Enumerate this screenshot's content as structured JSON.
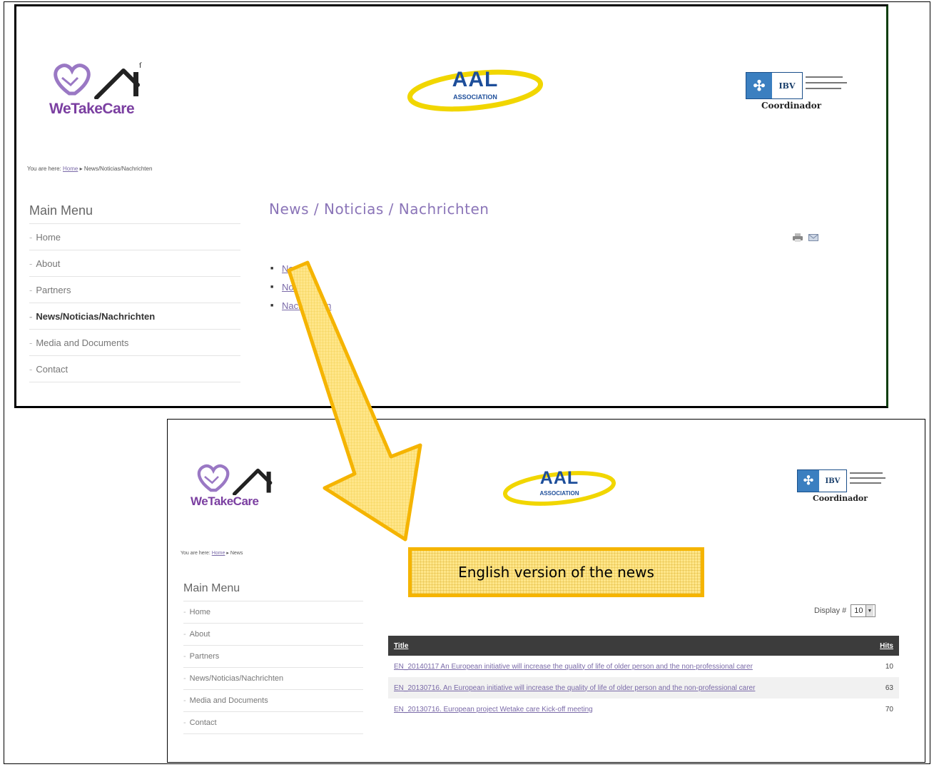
{
  "annotation": {
    "callout_text": "English version of the news",
    "arrow_color": "#f5b400"
  },
  "top_screenshot": {
    "logos": {
      "left_brand": "WeTakeCare",
      "center_brand": "AAL",
      "center_subtitle": "ASSOCIATION",
      "right_brand": "IBV",
      "right_caption": "Coordinador"
    },
    "breadcrumb": {
      "prefix": "You are here:",
      "home": "Home",
      "separator": "▸",
      "current": "News/Noticias/Nachrichten"
    },
    "menu": {
      "title": "Main Menu",
      "items": [
        {
          "label": "Home"
        },
        {
          "label": "About"
        },
        {
          "label": "Partners"
        },
        {
          "label": "News/Noticias/Nachrichten"
        },
        {
          "label": "Media and Documents"
        },
        {
          "label": "Contact"
        }
      ]
    },
    "page_title": "News / Noticias / Nachrichten",
    "categories": [
      "News",
      "Noticias",
      "Nachrichten"
    ],
    "icons": [
      "print-icon",
      "email-icon"
    ]
  },
  "bottom_screenshot": {
    "logos": {
      "left_brand": "WeTakeCare",
      "center_brand": "AAL",
      "center_subtitle": "ASSOCIATION",
      "right_brand": "IBV",
      "right_caption": "Coordinador"
    },
    "breadcrumb": {
      "prefix": "You are here:",
      "home": "Home",
      "separator": "▸",
      "current": "News"
    },
    "menu": {
      "title": "Main Menu",
      "items": [
        {
          "label": "Home"
        },
        {
          "label": "About"
        },
        {
          "label": "Partners"
        },
        {
          "label": "News/Noticias/Nachrichten"
        },
        {
          "label": "Media and Documents"
        },
        {
          "label": "Contact"
        }
      ]
    },
    "display": {
      "label": "Display #",
      "value": "10"
    },
    "table": {
      "headers": {
        "title": "Title",
        "hits": "Hits"
      },
      "rows": [
        {
          "title": "EN_20140117 An European initiative will increase the quality of life of older person and the non-professional carer",
          "hits": "10"
        },
        {
          "title": "EN_20130716. An European initiative will increase the quality of life of older person and the non-professional carer",
          "hits": "63"
        },
        {
          "title": "EN_20130716. European project Wetake care Kick-off meeting",
          "hits": "70"
        }
      ]
    }
  }
}
